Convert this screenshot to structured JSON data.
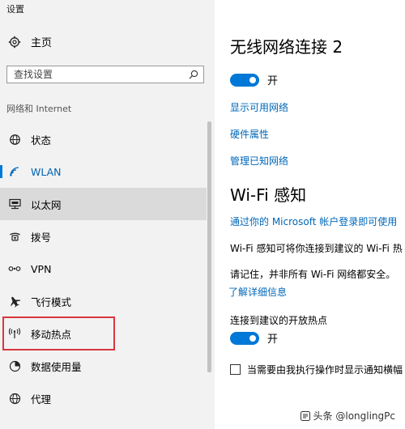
{
  "window": {
    "title": "设置"
  },
  "sidebar": {
    "home_label": "主页",
    "search_placeholder": "查找设置",
    "group_label": "网络和 Internet",
    "items": [
      {
        "label": "状态",
        "icon": "globe-status-icon"
      },
      {
        "label": "WLAN",
        "icon": "wifi-icon",
        "active": true
      },
      {
        "label": "以太网",
        "icon": "ethernet-icon"
      },
      {
        "label": "拨号",
        "icon": "dialup-icon"
      },
      {
        "label": "VPN",
        "icon": "vpn-icon"
      },
      {
        "label": "飞行模式",
        "icon": "airplane-icon"
      },
      {
        "label": "移动热点",
        "icon": "hotspot-icon"
      },
      {
        "label": "数据使用量",
        "icon": "data-usage-icon"
      },
      {
        "label": "代理",
        "icon": "globe-icon"
      }
    ]
  },
  "main": {
    "title": "无线网络连接 2",
    "wifi_toggle_label": "开",
    "links": {
      "show_networks": "显示可用网络",
      "hardware": "硬件属性",
      "manage_known": "管理已知网络"
    },
    "wifi_sense_title": "Wi-Fi 感知",
    "ms_account_link": "通过你的 Microsoft 帐户登录即可使用",
    "wifi_sense_desc": "Wi-Fi 感知可将你连接到建议的 Wi-Fi 热",
    "remember_text": "请记住，并非所有 Wi-Fi 网络都安全。",
    "learn_more": "了解详细信息",
    "open_hotspot_label": "连接到建议的开放热点",
    "open_hotspot_toggle": "开",
    "checkbox_label": "当需要由我执行操作时显示通知横幅"
  },
  "watermark": "头条 @longlingPc",
  "colors": {
    "accent": "#0078d7",
    "link": "#0067b8",
    "highlight": "#d9363e"
  }
}
